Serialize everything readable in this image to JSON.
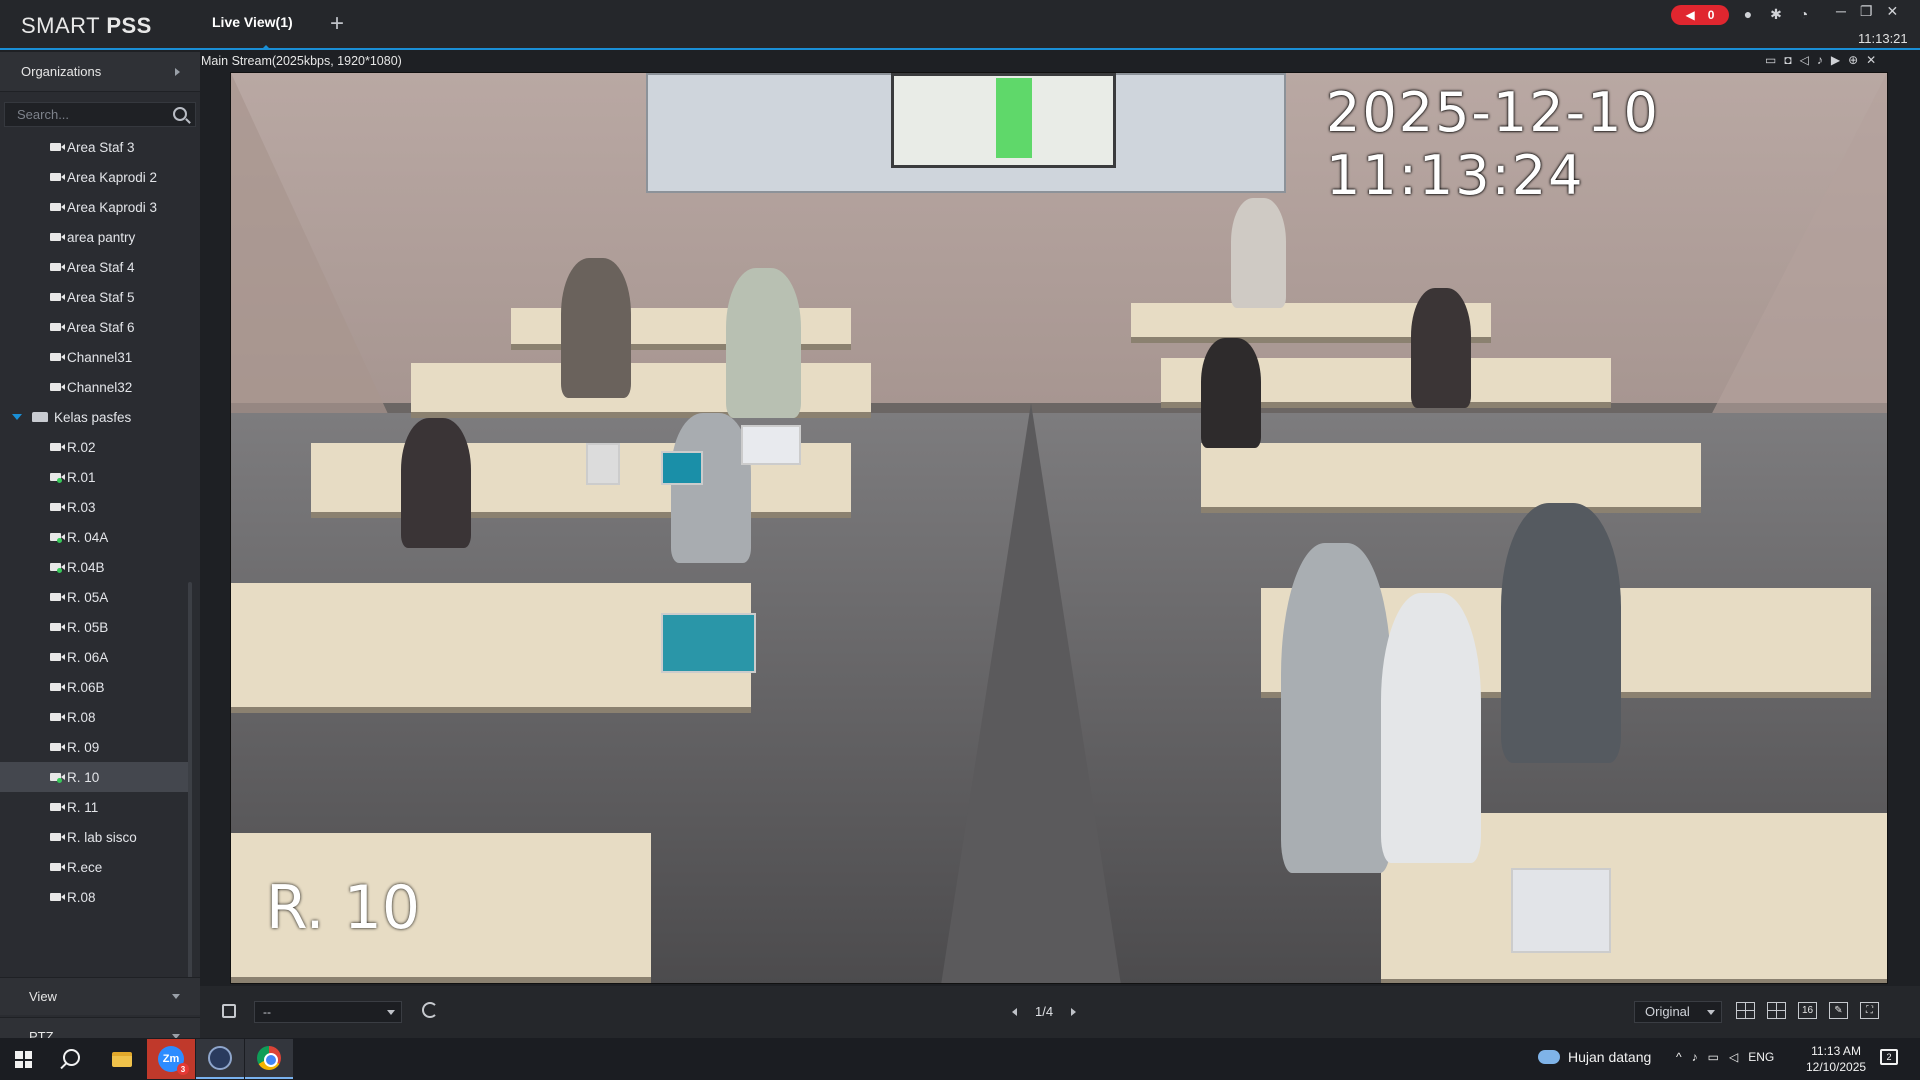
{
  "app": {
    "logo_text": "SMART PSS",
    "tab_label": "Live View(1)",
    "add_tab_glyph": "+",
    "alarm_count": "0",
    "clock": "11:13:21"
  },
  "sidebar": {
    "organizations_label": "Organizations",
    "search_placeholder": "Search...",
    "items": [
      {
        "label": "Area Staf 3",
        "online": false
      },
      {
        "label": "Area Kaprodi 2",
        "online": false
      },
      {
        "label": "Area Kaprodi 3",
        "online": false
      },
      {
        "label": "area pantry",
        "online": false
      },
      {
        "label": "Area Staf 4",
        "online": false
      },
      {
        "label": "Area Staf 5",
        "online": false
      },
      {
        "label": "Area Staf 6",
        "online": false
      },
      {
        "label": "Channel31",
        "online": false
      },
      {
        "label": "Channel32",
        "online": false
      }
    ],
    "group_label": "Kelas pasfes",
    "group_items": [
      {
        "label": "R.02",
        "online": false
      },
      {
        "label": "R.01",
        "online": true
      },
      {
        "label": "R.03",
        "online": false
      },
      {
        "label": "R. 04A",
        "online": true
      },
      {
        "label": "R.04B",
        "online": true
      },
      {
        "label": "R. 05A",
        "online": false
      },
      {
        "label": "R. 05B",
        "online": false
      },
      {
        "label": "R. 06A",
        "online": false
      },
      {
        "label": "R.06B",
        "online": false
      },
      {
        "label": "R.08",
        "online": false
      },
      {
        "label": "R. 09",
        "online": false
      },
      {
        "label": "R. 10",
        "online": true,
        "selected": true
      },
      {
        "label": "R. 11",
        "online": false
      },
      {
        "label": "R. lab sisco",
        "online": false
      },
      {
        "label": "R.ece",
        "online": false
      },
      {
        "label": "R.08",
        "online": false
      }
    ],
    "view_label": "View",
    "ptz_label": "PTZ"
  },
  "video": {
    "stream_label": "Main Stream(2025kbps, 1920*1080)",
    "osd_timestamp": "2025-12-10 11:13:24",
    "osd_channel_name": "R. 10"
  },
  "toolbar": {
    "view_select_value": "--",
    "page_indicator": "1/4",
    "ratio_value": "Original",
    "layout_16_label": "16"
  },
  "taskbar": {
    "weather_text": "Hujan datang",
    "language": "ENG",
    "time": "11:13 AM",
    "date": "12/10/2025",
    "zoom_badge": "3",
    "notification_count": "2"
  },
  "colors": {
    "accent": "#1a8fd6",
    "alarm": "#e0262f",
    "online_dot": "#38c85a",
    "selected_row": "#44474e"
  }
}
